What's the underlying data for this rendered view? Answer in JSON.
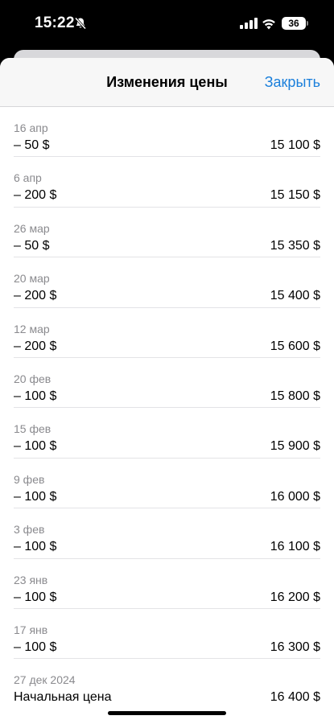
{
  "status_bar": {
    "time": "15:22",
    "battery": "36",
    "icons": [
      "bell-slash-icon",
      "cellular-signal-icon",
      "wifi-icon",
      "battery-icon"
    ]
  },
  "nav": {
    "title": "Изменения цены",
    "close_label": "Закрыть"
  },
  "price_changes": [
    {
      "date": "16 апр",
      "change": "– 50 $",
      "price": "15 100 $"
    },
    {
      "date": "6 апр",
      "change": "– 200 $",
      "price": "15 150 $"
    },
    {
      "date": "26 мар",
      "change": "– 50 $",
      "price": "15 350 $"
    },
    {
      "date": "20 мар",
      "change": "– 200 $",
      "price": "15 400 $"
    },
    {
      "date": "12 мар",
      "change": "– 200 $",
      "price": "15 600 $"
    },
    {
      "date": "20 фев",
      "change": "– 100 $",
      "price": "15 800 $"
    },
    {
      "date": "15 фев",
      "change": "– 100 $",
      "price": "15 900 $"
    },
    {
      "date": "9 фев",
      "change": "– 100 $",
      "price": "16 000 $"
    },
    {
      "date": "3 фев",
      "change": "– 100 $",
      "price": "16 100 $"
    },
    {
      "date": "23 янв",
      "change": "– 100 $",
      "price": "16 200 $"
    },
    {
      "date": "17 янв",
      "change": "– 100 $",
      "price": "16 300 $"
    },
    {
      "date": "27 дек 2024",
      "change": "Начальная цена",
      "price": "16 400 $"
    }
  ]
}
